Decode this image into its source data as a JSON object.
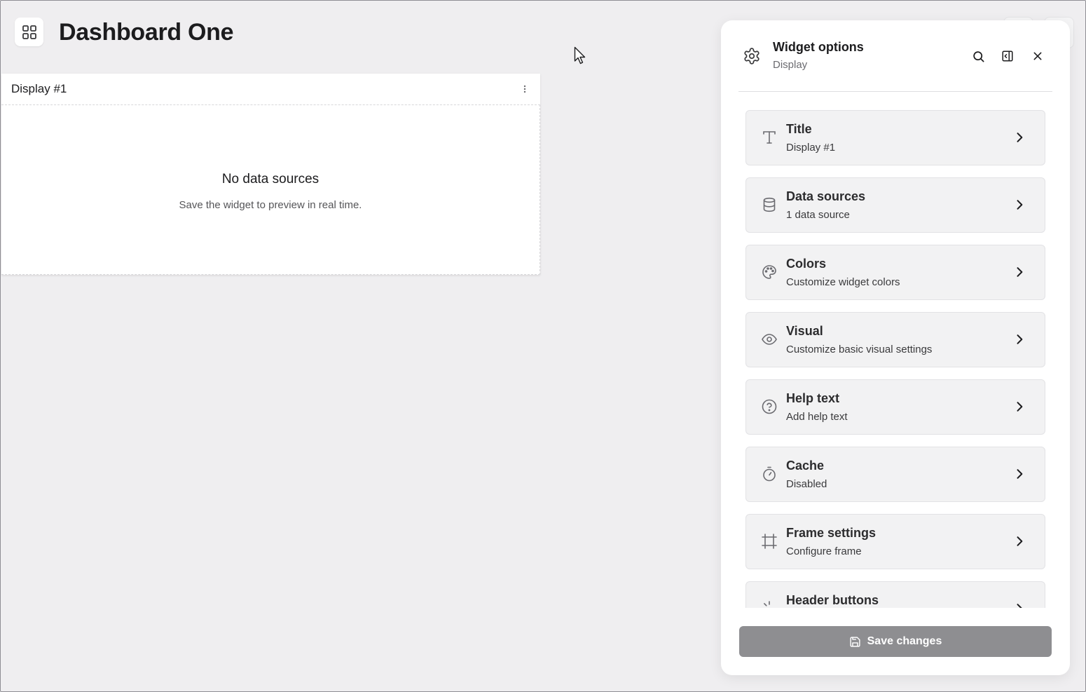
{
  "dashboard": {
    "title": "Dashboard One"
  },
  "widget": {
    "title": "Display #1",
    "empty_title": "No data sources",
    "empty_subtitle": "Save the widget to preview in real time."
  },
  "panel": {
    "title": "Widget options",
    "subtitle": "Display",
    "actions": [
      "search-icon",
      "collapse-panel-icon",
      "close-icon"
    ],
    "options": [
      {
        "icon": "text-icon",
        "label": "Title",
        "description": "Display #1"
      },
      {
        "icon": "database-icon",
        "label": "Data sources",
        "description": "1 data source"
      },
      {
        "icon": "palette-icon",
        "label": "Colors",
        "description": "Customize widget colors"
      },
      {
        "icon": "eye-icon",
        "label": "Visual",
        "description": "Customize basic visual settings"
      },
      {
        "icon": "help-circle-icon",
        "label": "Help text",
        "description": "Add help text"
      },
      {
        "icon": "timer-icon",
        "label": "Cache",
        "description": "Disabled"
      },
      {
        "icon": "frame-icon",
        "label": "Frame settings",
        "description": "Configure frame"
      },
      {
        "icon": "loader-icon",
        "label": "Header buttons",
        "description": ""
      }
    ],
    "save_label": "Save changes"
  },
  "colors": {
    "background": "#efeef0",
    "panel": "#ffffff",
    "option_bg": "#f2f2f3",
    "save_button": "#8e8e91"
  }
}
